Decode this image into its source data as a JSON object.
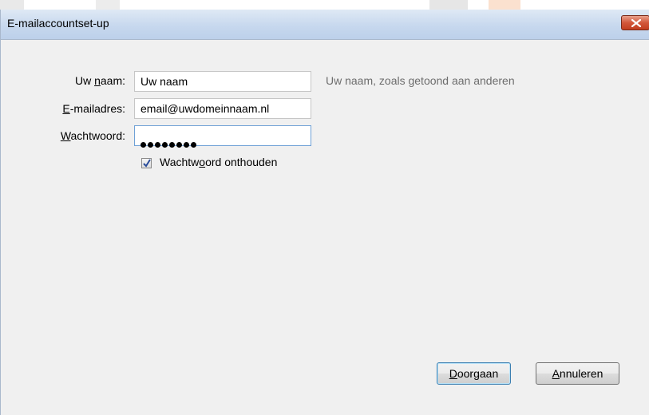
{
  "dialog": {
    "title": "E-mailaccountset-up",
    "close_icon": "close-icon"
  },
  "form": {
    "name": {
      "label_pre": "Uw ",
      "label_access": "n",
      "label_post": "aam:",
      "value": "Uw naam",
      "hint": "Uw naam, zoals getoond aan anderen"
    },
    "email": {
      "label_pre": "",
      "label_access": "E",
      "label_post": "-mailadres:",
      "value": "email@uwdomeinnaam.nl"
    },
    "password": {
      "label_pre": "",
      "label_access": "W",
      "label_post": "achtwoord:",
      "masked_length": 8
    },
    "remember": {
      "label_pre": "Wachtw",
      "label_access": "o",
      "label_post": "ord onthouden",
      "checked": true
    }
  },
  "buttons": {
    "continue": {
      "access": "D",
      "rest": "oorgaan"
    },
    "cancel": {
      "access": "A",
      "rest": "nnuleren"
    }
  },
  "colors": {
    "titlebar": "#c7d8ee",
    "dialog_bg": "#f0f0f0",
    "close_button": "#c23d1f",
    "hint_text": "#6d6d6d"
  }
}
